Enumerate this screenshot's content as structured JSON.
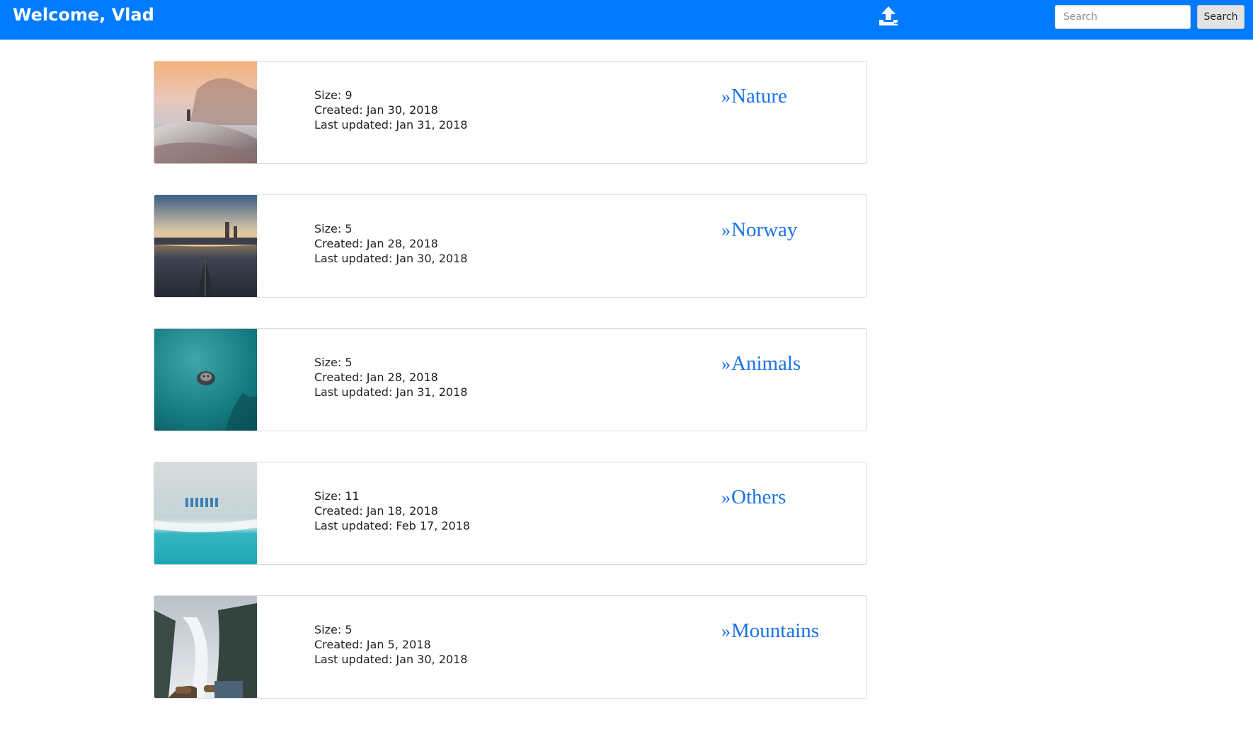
{
  "header": {
    "welcome": "Welcome, Vlad",
    "upload_icon": "upload-icon",
    "search": {
      "placeholder": "Search",
      "value": "",
      "button_label": "Search"
    },
    "brand_color": "#007bff"
  },
  "albums": [
    {
      "size": "Size: 9",
      "created": "Created: Jan 30, 2018",
      "updated": "Last updated: Jan 31, 2018",
      "link_arrow": "»",
      "name": "Nature",
      "thumb_icon": "mountain-sunset-photo"
    },
    {
      "size": "Size: 5",
      "created": "Created: Jan 28, 2018",
      "updated": "Last updated: Jan 30, 2018",
      "link_arrow": "»",
      "name": "Norway",
      "thumb_icon": "kayak-lake-photo"
    },
    {
      "size": "Size: 5",
      "created": "Created: Jan 28, 2018",
      "updated": "Last updated: Jan 31, 2018",
      "link_arrow": "»",
      "name": "Animals",
      "thumb_icon": "seal-underwater-photo"
    },
    {
      "size": "Size: 11",
      "created": "Created: Jan 18, 2018",
      "updated": "Last updated: Feb 17, 2018",
      "link_arrow": "»",
      "name": "Others",
      "thumb_icon": "beach-aerial-photo"
    },
    {
      "size": "Size: 5",
      "created": "Created: Jan 5, 2018",
      "updated": "Last updated: Jan 30, 2018",
      "link_arrow": "»",
      "name": "Mountains",
      "thumb_icon": "snowy-forest-photo"
    }
  ]
}
